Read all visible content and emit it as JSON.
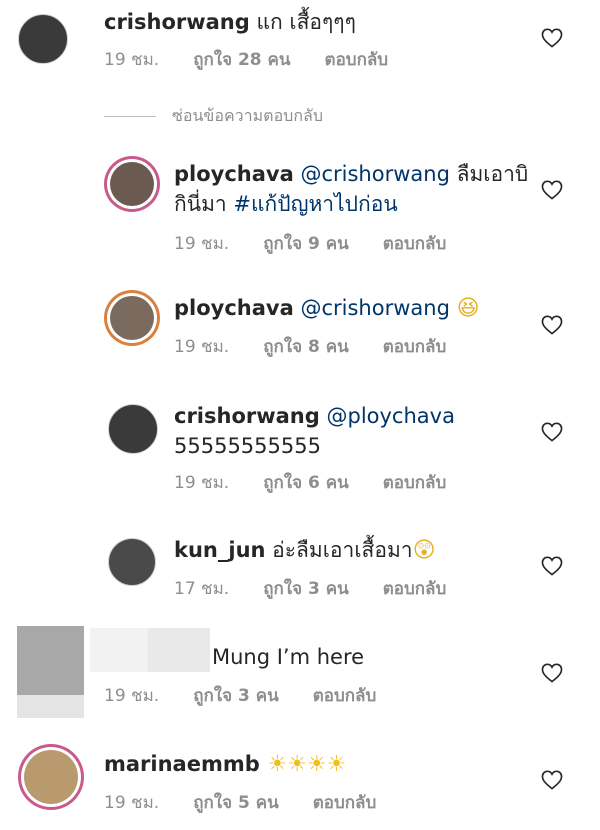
{
  "comments": [
    {
      "username": "crishorwang",
      "text": "แก เสื้อๆๆๆ",
      "time": "19 ชม.",
      "likes": "ถูกใจ 28 คน",
      "reply": "ตอบกลับ"
    },
    {
      "username": "ploychava",
      "mention": "@crishorwang",
      "text1": " ลืมเอาบิ",
      "text2": "กินี่มา ",
      "hashtag": "#แก้ปัญหาไปก่อน",
      "time": "19 ชม.",
      "likes": "ถูกใจ 9 คน",
      "reply": "ตอบกลับ"
    },
    {
      "username": "ploychava",
      "mention": "@crishorwang",
      "emoji": "😆",
      "time": "19 ชม.",
      "likes": "ถูกใจ 8 คน",
      "reply": "ตอบกลับ"
    },
    {
      "username": "crishorwang",
      "mention": "@ploychava",
      "text2": "55555555555",
      "time": "19 ชม.",
      "likes": "ถูกใจ 6 คน",
      "reply": "ตอบกลับ"
    },
    {
      "username": "kun_jun",
      "text": "อ่ะลืมเอาเสื้อมา",
      "emoji": "😲",
      "time": "17 ชม.",
      "likes": "ถูกใจ 3 คน",
      "reply": "ตอบกลับ"
    },
    {
      "text": "Mung I’m here",
      "time": "19 ชม.",
      "likes": "ถูกใจ 3 คน",
      "reply": "ตอบกลับ"
    },
    {
      "username": "marinaemmb",
      "suns": "☀☀☀☀",
      "time": "19 ชม.",
      "likes": "ถูกใจ 5 คน",
      "reply": "ตอบกลับ"
    }
  ],
  "hide_replies_label": "ซ่อนข้อความตอบกลับ"
}
